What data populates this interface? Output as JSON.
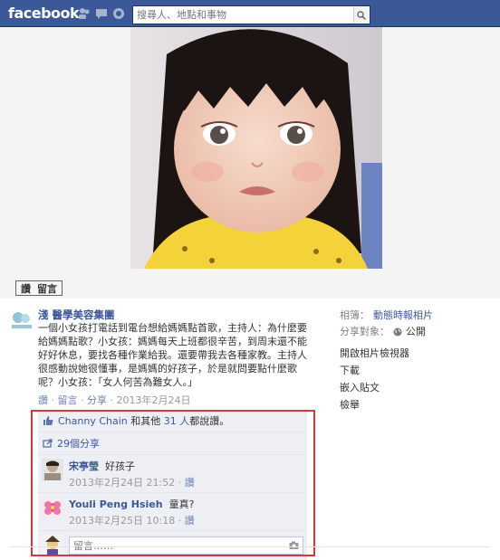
{
  "topbar": {
    "logo": "facebook",
    "search_placeholder": "搜尋人、地點和事物"
  },
  "photo_actions": {
    "like": "讚",
    "comment": "留言"
  },
  "post": {
    "page_name": "淺 醫學美容集團",
    "text": "一個小女孩打電話到電台想給媽媽點首歌，主持人：為什麼要給媽媽點歌？小女孩：媽媽每天上班都很辛苦，到周末還不能好好休息，要找各種作業給我。還要帶我去各種家教。主持人很感動說她很懂事，是媽媽的好孩子，於是就問要點什麼歌呢？小女孩：「女人何苦為難女人。」",
    "meta": {
      "like": "讚",
      "comment": "留言",
      "share": "分享",
      "date": "2013年2月24日",
      "sep": "·"
    }
  },
  "sidebar": {
    "album_label": "相簿：",
    "album_value": "動態時報相片",
    "audience_label": "分享對象：",
    "audience_value": "公開",
    "links": [
      "開啟相片檢視器",
      "下載",
      "嵌入貼文",
      "檢舉"
    ]
  },
  "feedback": {
    "likes_name": "Channy Chain",
    "likes_mid": "和其他",
    "likes_count": "31 人",
    "likes_tail": "都說讚。",
    "shares": "29個分享",
    "comments": [
      {
        "name": "宋亭瑩",
        "text": "好孩子",
        "time": "2013年2月24日 21:52",
        "action": "讚"
      },
      {
        "name": "Youli Peng Hsieh",
        "text": "童真?",
        "time": "2013年2月25日 10:18",
        "action": "讚"
      }
    ],
    "reply_placeholder": "留言……"
  },
  "colors": {
    "topbar": "#3b5998",
    "link": "#3b5998",
    "highlight": "#d9363e"
  }
}
